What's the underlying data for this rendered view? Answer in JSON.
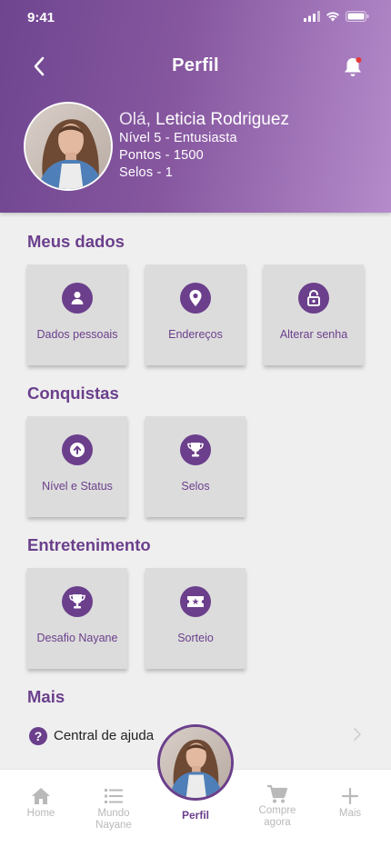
{
  "status_bar": {
    "time": "9:41"
  },
  "header": {
    "title": "Perfil",
    "greeting_prefix": "Olá,",
    "user_name": "Leticia Rodriguez",
    "level": "Nível 5 - Entusiasta",
    "points": "Pontos -  1500",
    "seals": "Selos -  1"
  },
  "sections": {
    "meus_dados": {
      "title": "Meus dados",
      "cards": [
        {
          "label": "Dados pessoais",
          "icon": "person-icon"
        },
        {
          "label": "Endereços",
          "icon": "location-pin-icon"
        },
        {
          "label": "Alterar senha",
          "icon": "lock-icon"
        }
      ]
    },
    "conquistas": {
      "title": "Conquistas",
      "cards": [
        {
          "label": "Nível e Status",
          "icon": "arrow-up-icon"
        },
        {
          "label": "Selos",
          "icon": "trophy-icon"
        }
      ]
    },
    "entretenimento": {
      "title": "Entretenimento",
      "cards": [
        {
          "label": "Desafio Nayane",
          "icon": "trophy-icon"
        },
        {
          "label": "Sorteio",
          "icon": "ticket-icon"
        }
      ]
    },
    "mais": {
      "title": "Mais",
      "help": {
        "label": "Central de ajuda"
      }
    }
  },
  "tabbar": {
    "home": "Home",
    "mundo_line1": "Mundo",
    "mundo_line2": "Nayane",
    "perfil": "Perfil",
    "compre_line1": "Compre",
    "compre_line2": "agora",
    "mais": "Mais"
  },
  "colors": {
    "accent": "#6b3f8c",
    "header_gradient_start": "#6f4590",
    "header_gradient_end": "#b58bcb",
    "card_bg": "#dcdcdc",
    "inactive_tab": "#b9b9b9",
    "notification_dot": "#e53935"
  }
}
